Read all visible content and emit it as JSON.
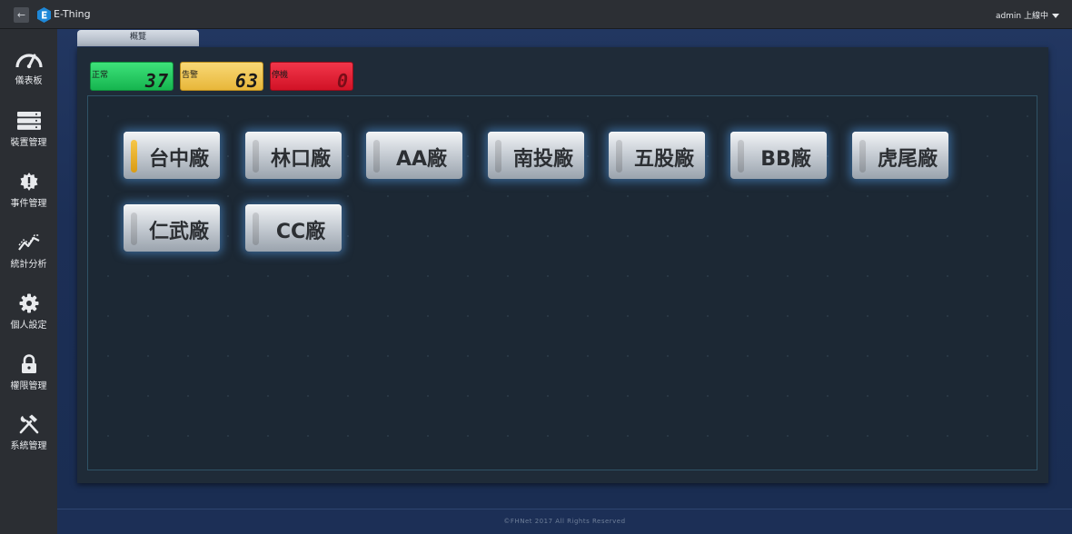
{
  "header": {
    "back_icon": "arrow-left-icon",
    "app_title": "E-Thing",
    "user_status": "admin 上線中"
  },
  "sidebar": {
    "items": [
      {
        "label": "儀表板",
        "icon": "dashboard-gauge-icon"
      },
      {
        "label": "裝置管理",
        "icon": "server-stack-icon"
      },
      {
        "label": "事件管理",
        "icon": "alert-gear-icon"
      },
      {
        "label": "統計分析",
        "icon": "line-chart-icon"
      },
      {
        "label": "個人設定",
        "icon": "gear-icon"
      },
      {
        "label": "權限管理",
        "icon": "lock-icon"
      },
      {
        "label": "系統管理",
        "icon": "tools-icon"
      }
    ]
  },
  "main": {
    "tab_label": "概覽",
    "status": {
      "normal": {
        "label": "正常",
        "count": "37",
        "color": "#22c85e"
      },
      "warning": {
        "label": "告警",
        "count": "63",
        "color": "#f0c850"
      },
      "stopped": {
        "label": "停機",
        "count": "0",
        "color": "#e8202f"
      }
    },
    "factories": [
      {
        "name": "台中廠",
        "active": true
      },
      {
        "name": "林口廠",
        "active": false
      },
      {
        "name": "AA廠",
        "active": false
      },
      {
        "name": "南投廠",
        "active": false
      },
      {
        "name": "五股廠",
        "active": false
      },
      {
        "name": "BB廠",
        "active": false
      },
      {
        "name": "虎尾廠",
        "active": false
      },
      {
        "name": "仁武廠",
        "active": false
      },
      {
        "name": "CC廠",
        "active": false
      }
    ]
  },
  "footer": {
    "copyright": "©FHNet 2017 All Rights Reserved"
  }
}
